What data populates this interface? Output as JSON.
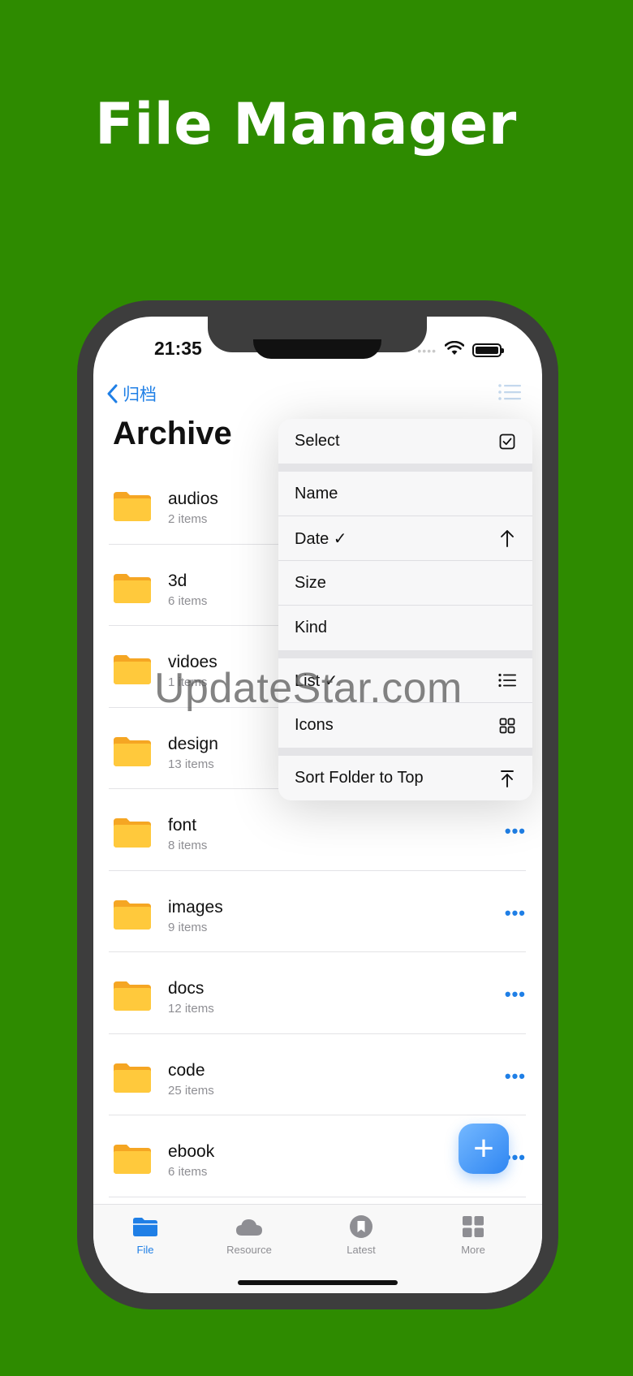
{
  "headline": "File Manager",
  "status": {
    "time": "21:35",
    "signal": "••••"
  },
  "nav": {
    "back_label": "归档"
  },
  "page_title": "Archive",
  "files": [
    {
      "name": "audios",
      "count": "2 items"
    },
    {
      "name": "3d",
      "count": "6 items"
    },
    {
      "name": "vidoes",
      "count": "1 items"
    },
    {
      "name": "design",
      "count": "13 items"
    },
    {
      "name": "font",
      "count": "8 items"
    },
    {
      "name": "images",
      "count": "9 items"
    },
    {
      "name": "docs",
      "count": "12 items"
    },
    {
      "name": "code",
      "count": "25 items"
    },
    {
      "name": "ebook",
      "count": "6 items"
    }
  ],
  "more_glyph": "•••",
  "menu": {
    "select": "Select",
    "name": "Name",
    "date": "Date ✓",
    "size": "Size",
    "kind": "Kind",
    "list": "List ✓",
    "icons": "Icons",
    "sort_folder": "Sort Folder to Top"
  },
  "watermark": "UpdateStar.com",
  "fab_glyph": "+",
  "tabs": [
    {
      "label": "File",
      "icon": "folder-icon",
      "active": true
    },
    {
      "label": "Resource",
      "icon": "cloud-icon"
    },
    {
      "label": "Latest",
      "icon": "bookmark-icon"
    },
    {
      "label": "More",
      "icon": "grid-icon"
    }
  ],
  "colors": {
    "background": "#2e8b00",
    "accent": "#1f7fe6",
    "folder": "#ffc93c"
  }
}
